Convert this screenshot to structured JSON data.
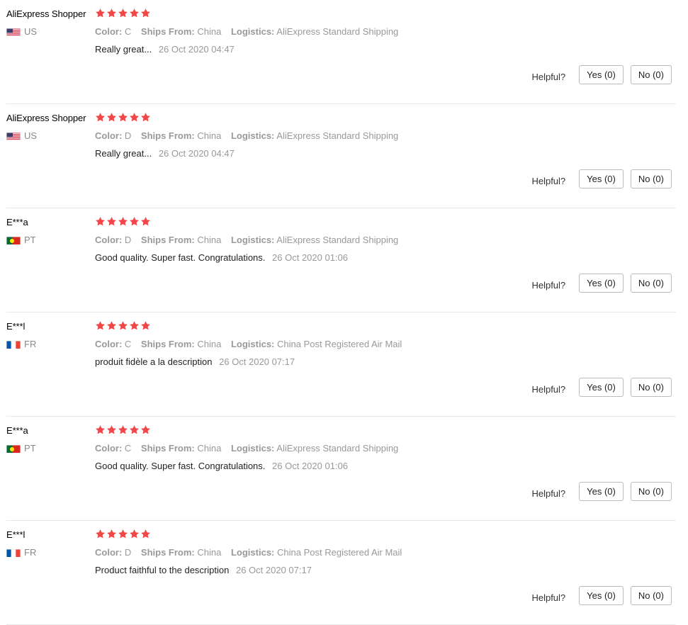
{
  "labels": {
    "color": "Color:",
    "ships_from": "Ships From:",
    "logistics": "Logistics:",
    "helpful": "Helpful?"
  },
  "colors": {
    "star": "#f04848",
    "muted": "#999999",
    "border": "#e8e8e8"
  },
  "reviews": [
    {
      "user": "AliExpress Shopper",
      "country": "US",
      "flag": "flag-us-icon",
      "rating": 5,
      "color": "C",
      "ships_from": "China",
      "logistics": "AliExpress Standard Shipping",
      "text": "Really great...",
      "date": "26 Oct 2020 04:47",
      "yes": "Yes (0)",
      "no": "No (0)"
    },
    {
      "user": "AliExpress Shopper",
      "country": "US",
      "flag": "flag-us-icon",
      "rating": 5,
      "color": "D",
      "ships_from": "China",
      "logistics": "AliExpress Standard Shipping",
      "text": "Really great...",
      "date": "26 Oct 2020 04:47",
      "yes": "Yes (0)",
      "no": "No (0)"
    },
    {
      "user": "E***a",
      "country": "PT",
      "flag": "flag-pt-icon",
      "rating": 5,
      "color": "D",
      "ships_from": "China",
      "logistics": "AliExpress Standard Shipping",
      "text": "Good quality. Super fast. Congratulations.",
      "date": "26 Oct 2020 01:06",
      "yes": "Yes (0)",
      "no": "No (0)"
    },
    {
      "user": "E***l",
      "country": "FR",
      "flag": "flag-fr-icon",
      "rating": 5,
      "color": "C",
      "ships_from": "China",
      "logistics": "China Post Registered Air Mail",
      "text": "produit fidèle a la description",
      "date": "26 Oct 2020 07:17",
      "yes": "Yes (0)",
      "no": "No (0)"
    },
    {
      "user": "E***a",
      "country": "PT",
      "flag": "flag-pt-icon",
      "rating": 5,
      "color": "C",
      "ships_from": "China",
      "logistics": "AliExpress Standard Shipping",
      "text": "Good quality. Super fast. Congratulations.",
      "date": "26 Oct 2020 01:06",
      "yes": "Yes (0)",
      "no": "No (0)"
    },
    {
      "user": "E***l",
      "country": "FR",
      "flag": "flag-fr-icon",
      "rating": 5,
      "color": "D",
      "ships_from": "China",
      "logistics": "China Post Registered Air Mail",
      "text": "Product faithful to the description",
      "date": "26 Oct 2020 07:17",
      "yes": "Yes (0)",
      "no": "No (0)"
    }
  ]
}
